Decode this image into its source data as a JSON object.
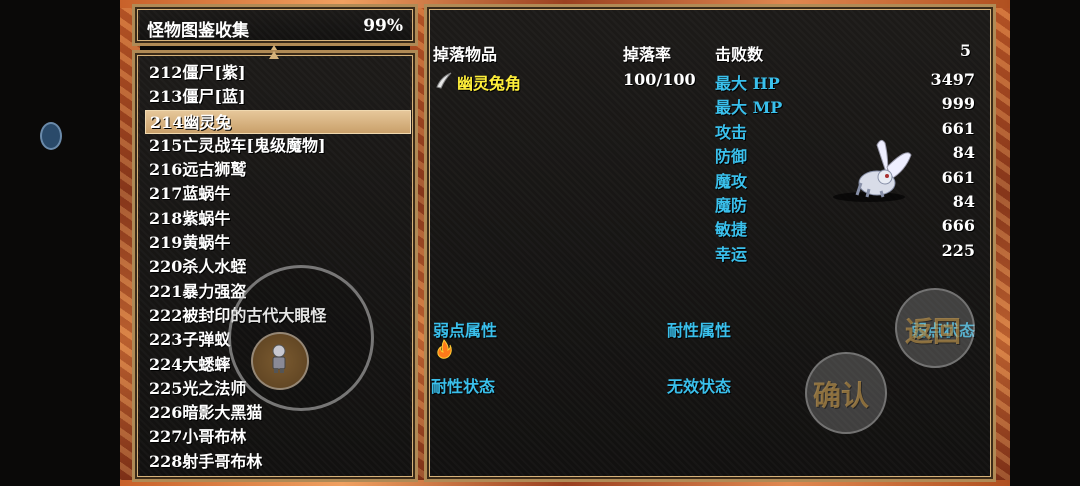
{
  "header": {
    "title": "怪物图鉴收集",
    "completion": "99%"
  },
  "monster_list": [
    "212僵尸[紫]",
    "213僵尸[蓝]",
    "214幽灵兔",
    "215亡灵战车[鬼级魔物]",
    "216远古狮鹫",
    "217蓝蜗牛",
    "218紫蜗牛",
    "219黄蜗牛",
    "220杀人水蛭",
    "221暴力强盗",
    "222被封印的古代大眼怪",
    "223子弹蚁",
    "224大蟋蟀",
    "225光之法师",
    "226暗影大黑猫",
    "227小哥布林",
    "228射手哥布林"
  ],
  "selected_index": 2,
  "detail": {
    "drop_header": "掉落物品",
    "rate_header": "掉落率",
    "defeat_label": "击败数",
    "defeat_count": "5",
    "drop_item": "幽灵兔角",
    "drop_rate": "100/100",
    "stats": [
      {
        "label": "最大 HP",
        "value": "3497"
      },
      {
        "label": "最大 MP",
        "value": "999"
      },
      {
        "label": "攻击",
        "value": "661"
      },
      {
        "label": "防御",
        "value": "84"
      },
      {
        "label": "魔攻",
        "value": "661"
      },
      {
        "label": "魔防",
        "value": "84"
      },
      {
        "label": "敏捷",
        "value": "666"
      },
      {
        "label": "幸运",
        "value": "225"
      }
    ],
    "weak_attr": "弱点属性",
    "resist_attr": "耐性属性",
    "weak_state": "弱点状态",
    "resist_state": "耐性状态",
    "immune_state": "无效状态"
  },
  "controls": {
    "back": "返回",
    "confirm": "确认"
  },
  "icons": {
    "drop_item_icon": "horn-icon",
    "weakness_icon": "fire-icon",
    "monster": "ghost-rabbit-sprite"
  }
}
